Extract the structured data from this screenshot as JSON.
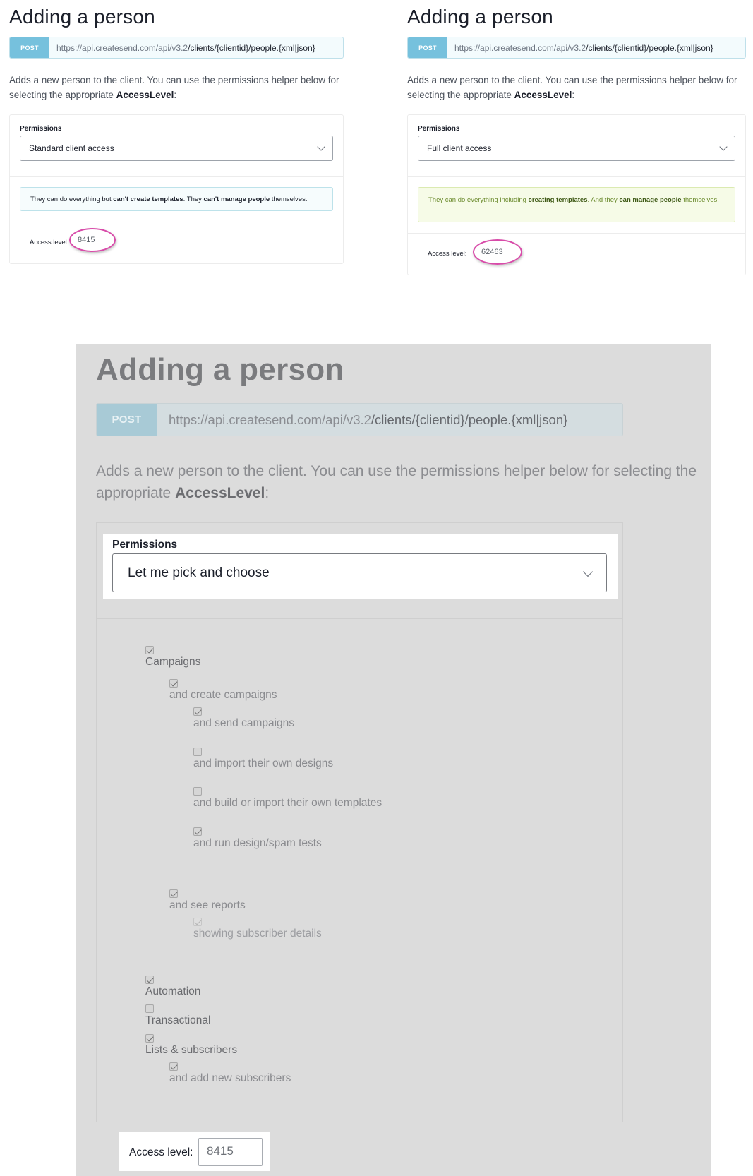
{
  "left_panel": {
    "title": "Adding a person",
    "method": "POST",
    "url_base": "https://api.createsend.com/api/v3.2",
    "url_path": "/clients/{clientid}/people.{xml|json}",
    "desc_text": "Adds a new person to the client. You can use the permissions helper below for selecting the appropriate ",
    "desc_bold": "AccessLevel",
    "desc_end": ":",
    "permissions_label": "Permissions",
    "permissions_value": "Standard client access",
    "message": {
      "p1": "They can do everything but ",
      "b1": "can't create templates",
      "p2": ". They ",
      "b2": "can't manage people",
      "p3": " themselves."
    },
    "access_label": "Access level:",
    "access_value": "8415"
  },
  "right_panel": {
    "title": "Adding a person",
    "method": "POST",
    "url_base": "https://api.createsend.com/api/v3.2",
    "url_path": "/clients/{clientid}/people.{xml|json}",
    "desc_text": "Adds a new person to the client. You can use the permissions helper below for selecting the appropriate ",
    "desc_bold": "AccessLevel",
    "desc_end": ":",
    "permissions_label": "Permissions",
    "permissions_value": "Full client access",
    "message": {
      "p1": "They can do everything including ",
      "b1": "creating templates",
      "p2": ". And they ",
      "b2": "can manage people",
      "p3": " themselves."
    },
    "access_label": "Access level:",
    "access_value": "62463"
  },
  "bottom_panel": {
    "title": "Adding a person",
    "method": "POST",
    "url_base": "https://api.createsend.com/api/v3.2",
    "url_path": "/clients/{clientid}/people.{xml|json}",
    "desc_text": "Adds a new person to the client. You can use the permissions helper below for selecting the appropriate ",
    "desc_bold": "AccessLevel",
    "desc_end": ":",
    "permissions_label": "Permissions",
    "permissions_value": "Let me pick and choose",
    "checkboxes": {
      "campaigns": {
        "label": "Campaigns",
        "checked": true
      },
      "create_campaigns": {
        "label": "and create campaigns",
        "checked": true
      },
      "send_campaigns": {
        "label": "and send campaigns",
        "checked": true
      },
      "import_designs": {
        "label": "and import their own designs",
        "checked": false
      },
      "build_templates": {
        "label": "and build or import their own templates",
        "checked": false
      },
      "design_spam_tests": {
        "label": "and run design/spam tests",
        "checked": true
      },
      "see_reports": {
        "label": "and see reports",
        "checked": true
      },
      "subscriber_details": {
        "label": "showing subscriber details",
        "checked": true
      },
      "automation": {
        "label": "Automation",
        "checked": true
      },
      "transactional": {
        "label": "Transactional",
        "checked": false
      },
      "lists_subscribers": {
        "label": "Lists & subscribers",
        "checked": true
      },
      "add_subscribers": {
        "label": "and add new subscribers",
        "checked": true
      }
    },
    "access_label": "Access level:",
    "access_value": "8415"
  }
}
